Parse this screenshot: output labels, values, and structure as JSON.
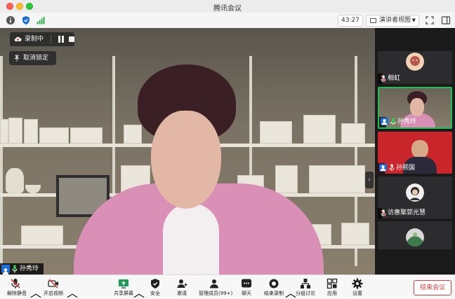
{
  "window": {
    "title": "腾讯会议"
  },
  "toolbar": {
    "timer": "43:27",
    "view_label": "演讲者视图"
  },
  "recording": {
    "status": "录制中",
    "unlock_label": "取消锁定"
  },
  "main_video": {
    "speaker_name": "孙秀玲"
  },
  "participants": [
    {
      "name": "相虹"
    },
    {
      "name": "孙秀玲"
    },
    {
      "name": "孙熙国"
    },
    {
      "name": "访惠聚郭光慧"
    }
  ],
  "bottom_bar": {
    "mute": "解除静音",
    "video": "开启视频",
    "share": "共享屏幕",
    "security": "安全",
    "invite": "邀请",
    "members": "管理成员(99+)",
    "chat": "聊天",
    "end_record": "结束录制",
    "breakout": "分组讨论",
    "apps": "应用",
    "settings": "设置",
    "end_meeting": "结束会议"
  },
  "colors": {
    "accent": "#1e6fd9",
    "active_border": "#1fbf55",
    "end_red": "#e03c3c"
  }
}
